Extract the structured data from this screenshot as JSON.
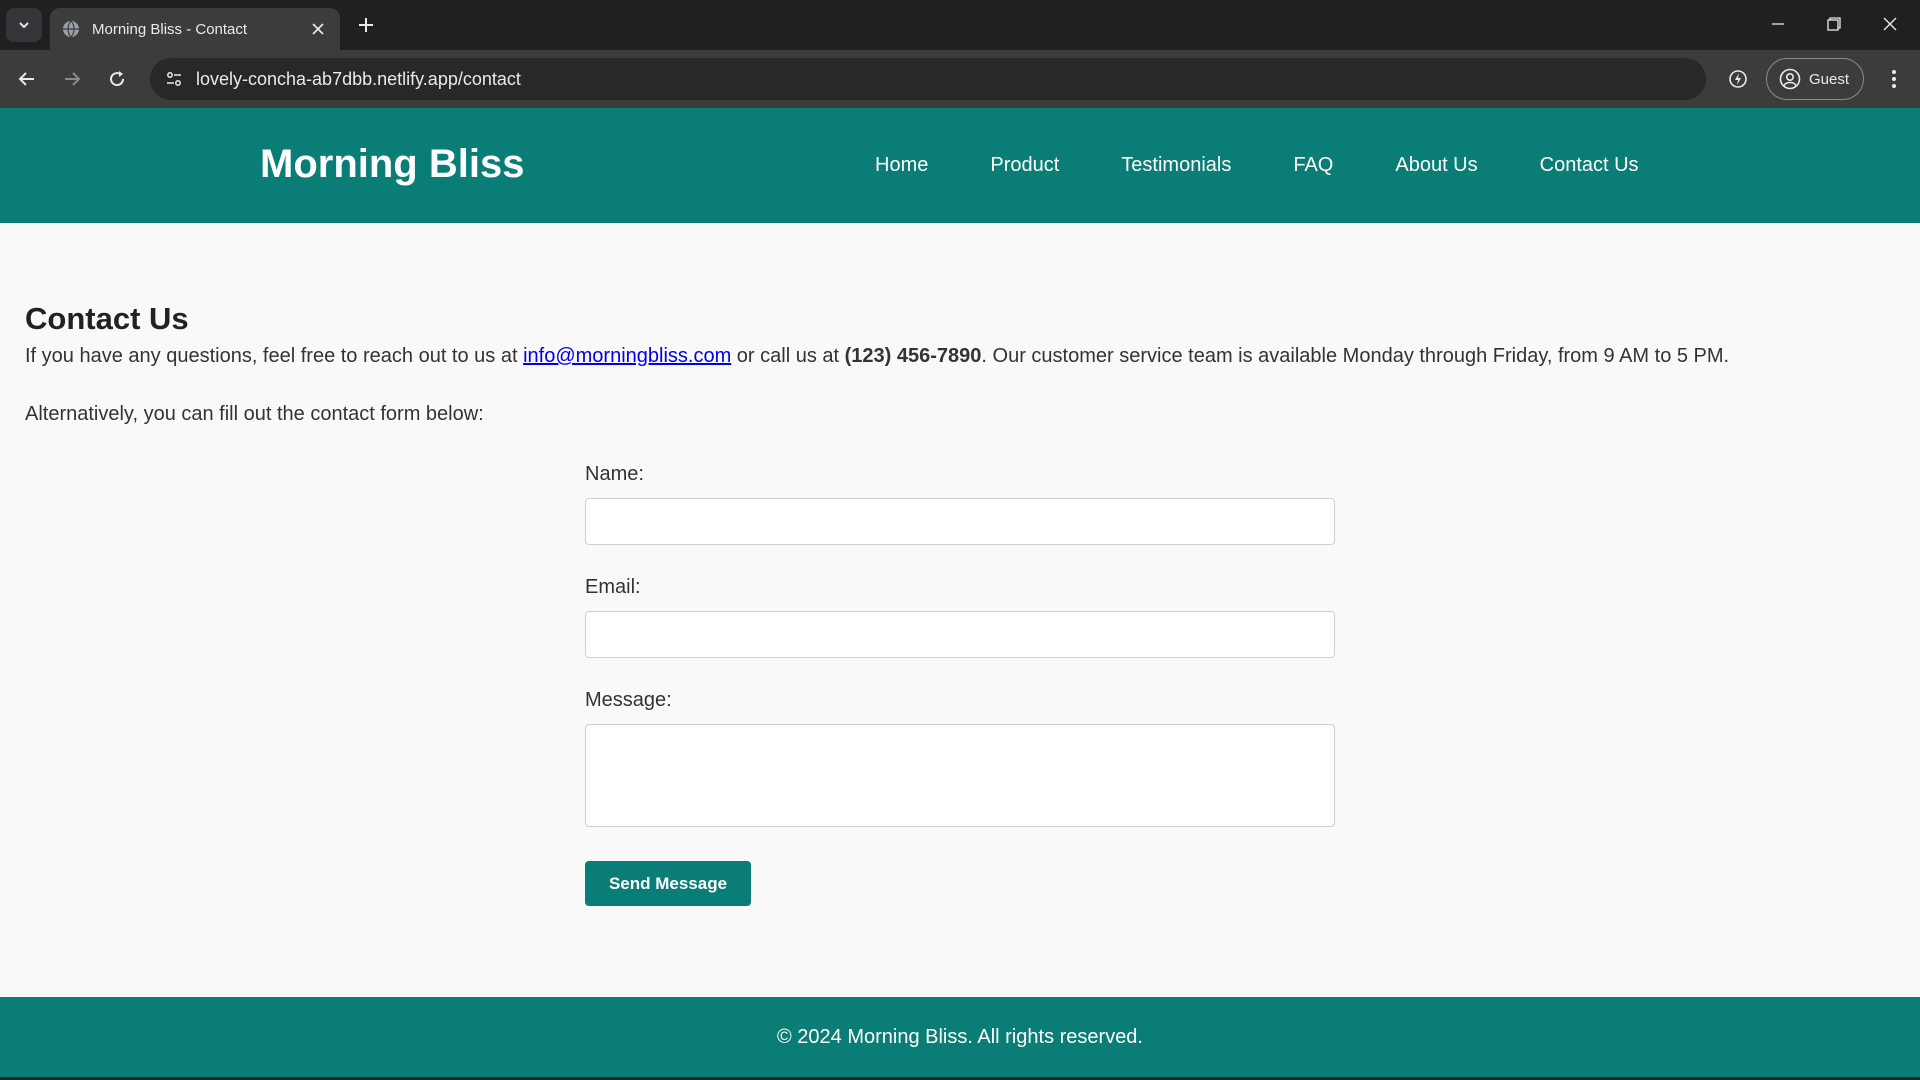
{
  "browser": {
    "tab_title": "Morning Bliss - Contact",
    "url": "lovely-concha-ab7dbb.netlify.app/contact",
    "profile_name": "Guest"
  },
  "site": {
    "logo": "Morning Bliss",
    "nav": [
      "Home",
      "Product",
      "Testimonials",
      "FAQ",
      "About Us",
      "Contact Us"
    ],
    "brand_color": "#0a7d76"
  },
  "contact": {
    "heading": "Contact Us",
    "intro_before": "If you have any questions, feel free to reach out to us at ",
    "email": "info@morningbliss.com",
    "intro_middle": " or call us at ",
    "phone": "(123) 456-7890",
    "intro_after": ". Our customer service team is available Monday through Friday, from 9 AM to 5 PM.",
    "alternative": "Alternatively, you can fill out the contact form below:"
  },
  "form": {
    "name_label": "Name:",
    "email_label": "Email:",
    "message_label": "Message:",
    "name_value": "",
    "email_value": "",
    "message_value": "",
    "submit_label": "Send Message"
  },
  "footer": {
    "text": "© 2024 Morning Bliss. All rights reserved."
  },
  "icons": [
    "tab-search-icon",
    "globe-icon",
    "close-icon",
    "plus-icon",
    "minimize-icon",
    "restore-icon",
    "window-close-icon",
    "back-arrow-icon",
    "forward-arrow-icon",
    "reload-icon",
    "site-info-icon",
    "extension-icon",
    "profile-icon",
    "kebab-menu-icon"
  ]
}
